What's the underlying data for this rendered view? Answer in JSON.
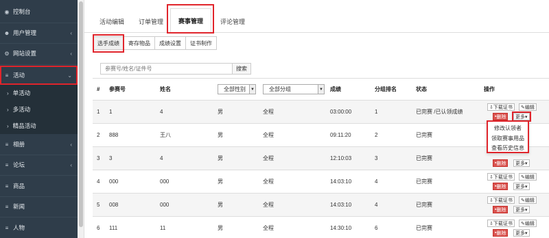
{
  "sidebar": {
    "items": [
      {
        "icon": "dashboard-icon",
        "glyph": "◉",
        "label": "控制台",
        "chev": ""
      },
      {
        "icon": "users-icon",
        "glyph": "☻",
        "label": "用户管理",
        "chev": "‹"
      },
      {
        "icon": "gear-icon",
        "glyph": "⚙",
        "label": "网站设置",
        "chev": "‹"
      },
      {
        "icon": "list-icon",
        "glyph": "≡",
        "label": "活动",
        "chev": "⌄"
      },
      {
        "icon": "list-icon",
        "glyph": "≡",
        "label": "相册",
        "chev": "‹"
      },
      {
        "icon": "list-icon",
        "glyph": "≡",
        "label": "论坛",
        "chev": "‹"
      },
      {
        "icon": "list-icon",
        "glyph": "≡",
        "label": "商品",
        "chev": ""
      },
      {
        "icon": "list-icon",
        "glyph": "≡",
        "label": "新闻",
        "chev": ""
      },
      {
        "icon": "list-icon",
        "glyph": "≡",
        "label": "人物",
        "chev": ""
      }
    ],
    "subitems": [
      {
        "label": "单活动"
      },
      {
        "label": "多活动"
      },
      {
        "label": "精品活动"
      }
    ]
  },
  "tabs": [
    {
      "label": "活动编辑"
    },
    {
      "label": "订单管理"
    },
    {
      "label": "赛事管理"
    },
    {
      "label": "评论管理"
    }
  ],
  "subtabs": [
    {
      "label": "选手成绩"
    },
    {
      "label": "寄存物品"
    },
    {
      "label": "成绩设置"
    },
    {
      "label": "证书制作"
    }
  ],
  "search": {
    "placeholder": "参赛号/姓名/证件号",
    "button": "搜索"
  },
  "table": {
    "headers": {
      "index": "#",
      "number": "参赛号",
      "name": "姓名",
      "gender_select": "全部性别",
      "group_select": "全部分组",
      "score": "成绩",
      "rank": "分组排名",
      "status": "状态",
      "ops": "操作"
    },
    "rows": [
      {
        "index": "1",
        "number": "1",
        "name": "4",
        "gender": "男",
        "group": "全程",
        "score": "03:00:00",
        "rank": "1",
        "status": "已完赛 /已认领成绩"
      },
      {
        "index": "2",
        "number": "888",
        "name": "王八",
        "gender": "男",
        "group": "全程",
        "score": "09:11:20",
        "rank": "2",
        "status": "已完赛"
      },
      {
        "index": "3",
        "number": "3",
        "name": "4",
        "gender": "男",
        "group": "全程",
        "score": "12:10:03",
        "rank": "3",
        "status": "已完赛"
      },
      {
        "index": "4",
        "number": "000",
        "name": "000",
        "gender": "男",
        "group": "全程",
        "score": "14:03:10",
        "rank": "4",
        "status": "已完赛"
      },
      {
        "index": "5",
        "number": "008",
        "name": "000",
        "gender": "男",
        "group": "全程",
        "score": "14:03:10",
        "rank": "4",
        "status": "已完赛"
      },
      {
        "index": "6",
        "number": "111",
        "name": "11",
        "gender": "男",
        "group": "全程",
        "score": "14:30:10",
        "rank": "6",
        "status": "已完赛"
      }
    ],
    "ops": {
      "download": "下载证书",
      "edit": "编辑",
      "delete": "删除",
      "more": "更多"
    }
  },
  "dropdown": {
    "items": [
      {
        "label": "修改认领者"
      },
      {
        "label": "领取赛事用品"
      },
      {
        "label": "查看历史信息"
      }
    ]
  },
  "colors": {
    "sidebar_bg": "#2f3d4a",
    "highlight": "#e0242b",
    "delete_button": "#d9534f"
  }
}
